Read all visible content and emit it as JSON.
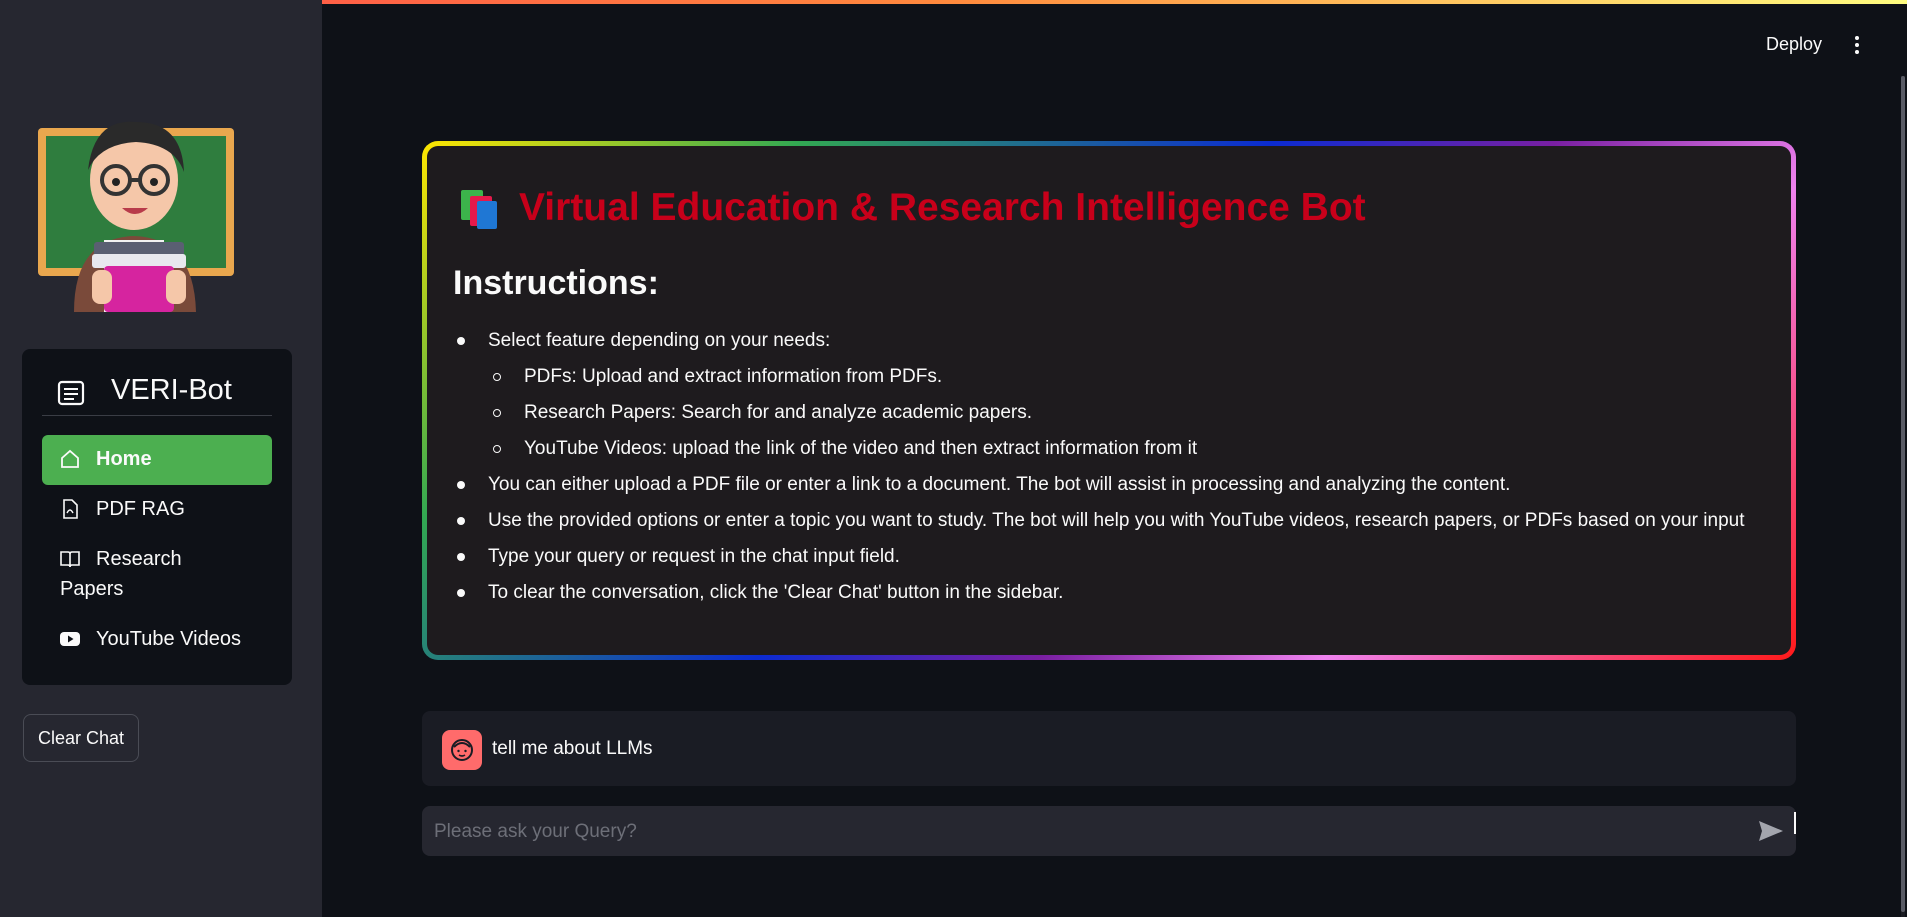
{
  "sidebar": {
    "title": "VERI-Bot",
    "items": [
      {
        "label": "Home",
        "icon": "house-icon",
        "active": true
      },
      {
        "label": "PDF RAG",
        "icon": "file-pdf-icon",
        "active": false
      },
      {
        "label": "Research",
        "label2": "Papers",
        "icon": "book-open-icon",
        "active": false
      },
      {
        "label": "YouTube Videos",
        "icon": "youtube-icon",
        "active": false
      }
    ],
    "clear_button": "Clear Chat"
  },
  "header": {
    "deploy_label": "Deploy"
  },
  "main": {
    "title": "Virtual Education & Research Intelligence Bot",
    "instructions_heading": "Instructions:",
    "bullets": {
      "b1": "Select feature depending on your needs:",
      "sub1": "PDFs: Upload and extract information from PDFs.",
      "sub2": "Research Papers: Search for and analyze academic papers.",
      "sub3": "YouTube Videos: upload the link of the video and then extract information from it",
      "b2": "You can either upload a PDF file or enter a link to a document. The bot will assist in processing and analyzing the content.",
      "b3": "Use the provided options or enter a topic you want to study. The bot will help you with YouTube videos, research papers, or PDFs based on your input",
      "b4": "Type your query or request in the chat input field.",
      "b5": "To clear the conversation, click the 'Clear Chat' button in the sidebar."
    }
  },
  "chat": {
    "user_message": "tell me about LLMs",
    "input_placeholder": "Please ask your Query?"
  },
  "colors": {
    "accent_green": "#4caf50",
    "title_red": "#c8001a",
    "background": "#0e1117",
    "sidebar": "#262730"
  }
}
